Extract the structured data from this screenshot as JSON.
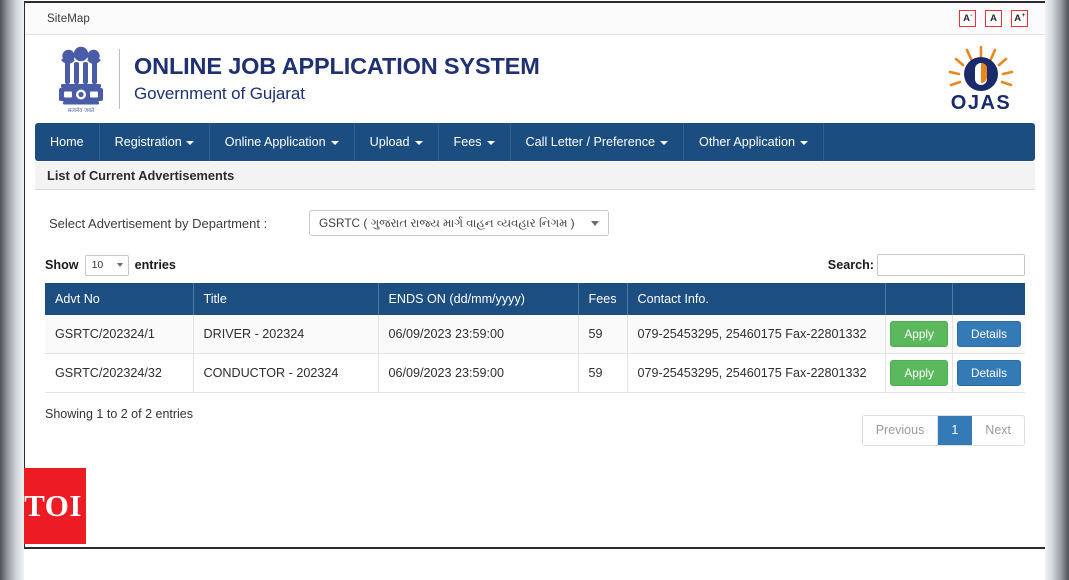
{
  "topbar": {
    "sitemap_label": "SiteMap",
    "font_controls": [
      {
        "name": "font-decrease",
        "letter": "A",
        "sup": "-"
      },
      {
        "name": "font-normal",
        "letter": "A",
        "sup": ""
      },
      {
        "name": "font-increase",
        "letter": "A",
        "sup": "+"
      }
    ]
  },
  "header": {
    "emblem_icon": "ashoka-emblem-icon",
    "emblem_motto": "सत्यमेव जयते",
    "title_main": "ONLINE JOB APPLICATION SYSTEM",
    "title_sub": "Government of Gujarat",
    "logo_icon": "ojas-sun-logo-icon",
    "logo_text": "OJAS",
    "colors": {
      "title": "#1f3172",
      "logo_sun": "#e8871e",
      "logo_circle": "#1b2a6b"
    }
  },
  "nav": {
    "items": [
      {
        "label": "Home",
        "caret": false
      },
      {
        "label": "Registration",
        "caret": true
      },
      {
        "label": "Online Application",
        "caret": true
      },
      {
        "label": "Upload",
        "caret": true
      },
      {
        "label": "Fees",
        "caret": true
      },
      {
        "label": "Call Letter / Preference",
        "caret": true
      },
      {
        "label": "Other Application",
        "caret": true
      }
    ],
    "background": "#1c4d80"
  },
  "section": {
    "heading": "List of Current Advertisements"
  },
  "department": {
    "label": "Select Advertisement by Department :",
    "selected": "GSRTC ( ગુજરાત રાજ્ય માર્ગ વાહન વ્યવહાર નિગમ )"
  },
  "controls": {
    "show_label": "Show",
    "entries_label": "entries",
    "page_length": "10",
    "search_label": "Search:",
    "search_value": "",
    "search_placeholder": ""
  },
  "table": {
    "columns": [
      "Advt No",
      "Title",
      "ENDS ON (dd/mm/yyyy)",
      "Fees",
      "Contact Info.",
      "",
      ""
    ],
    "rows": [
      {
        "advt_no": "GSRTC/202324/1",
        "title": "DRIVER - 202324",
        "ends_on": "06/09/2023 23:59:00",
        "fees": "59",
        "contact": "079-25453295, 25460175 Fax-22801332",
        "apply_label": "Apply",
        "details_label": "Details"
      },
      {
        "advt_no": "GSRTC/202324/32",
        "title": "CONDUCTOR - 202324",
        "ends_on": "06/09/2023 23:59:00",
        "fees": "59",
        "contact": "079-25453295, 25460175 Fax-22801332",
        "apply_label": "Apply",
        "details_label": "Details"
      }
    ],
    "colors": {
      "header_bg": "#1d4e82",
      "apply_btn": "#5cb85c",
      "details_btn": "#337ab7"
    }
  },
  "footer": {
    "info": "Showing 1 to 2 of 2 entries",
    "pagination": {
      "previous": "Previous",
      "pages": [
        "1"
      ],
      "next": "Next",
      "active": "1"
    }
  },
  "watermark": {
    "text": "TOI",
    "color": "#ed1c24"
  }
}
